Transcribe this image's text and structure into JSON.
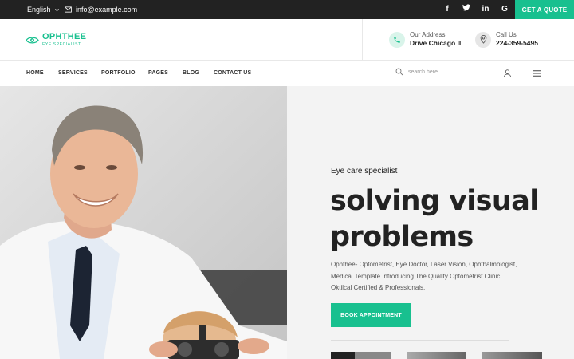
{
  "topbar": {
    "language": "English",
    "email": "info@example.com",
    "quote_button": "GET A QUOTE"
  },
  "brand": {
    "name": "OPHTHEE",
    "tagline": "EYE SPECIALIST"
  },
  "contact": {
    "address_label": "Our Address",
    "address_value": "Drive Chicago IL",
    "call_label": "Call Us",
    "call_value": "224-359-5495"
  },
  "nav": {
    "items": [
      "HOME",
      "SERVICES",
      "PORTFOLIO",
      "PAGES",
      "BLOG",
      "CONTACT US"
    ],
    "search_placeholder": "search here"
  },
  "hero": {
    "eyebrow": "Eye care specialist",
    "headline_line1": "solving visual",
    "headline_line2": "problems",
    "description": "Ophthee- Optometrist, Eye Doctor, Laser Vision, Ophthalmologist, Medical Template Introducing The Quality Optometrist Clinic Oktilcal Certified & Professionals.",
    "cta": "BOOK APPOINTMENT"
  },
  "colors": {
    "accent": "#18c08f",
    "topbar_bg": "#222222",
    "hero_right_bg": "#f3f3f3"
  },
  "icons": {
    "social": [
      "facebook-icon",
      "twitter-icon",
      "linkedin-icon",
      "google-icon"
    ]
  }
}
